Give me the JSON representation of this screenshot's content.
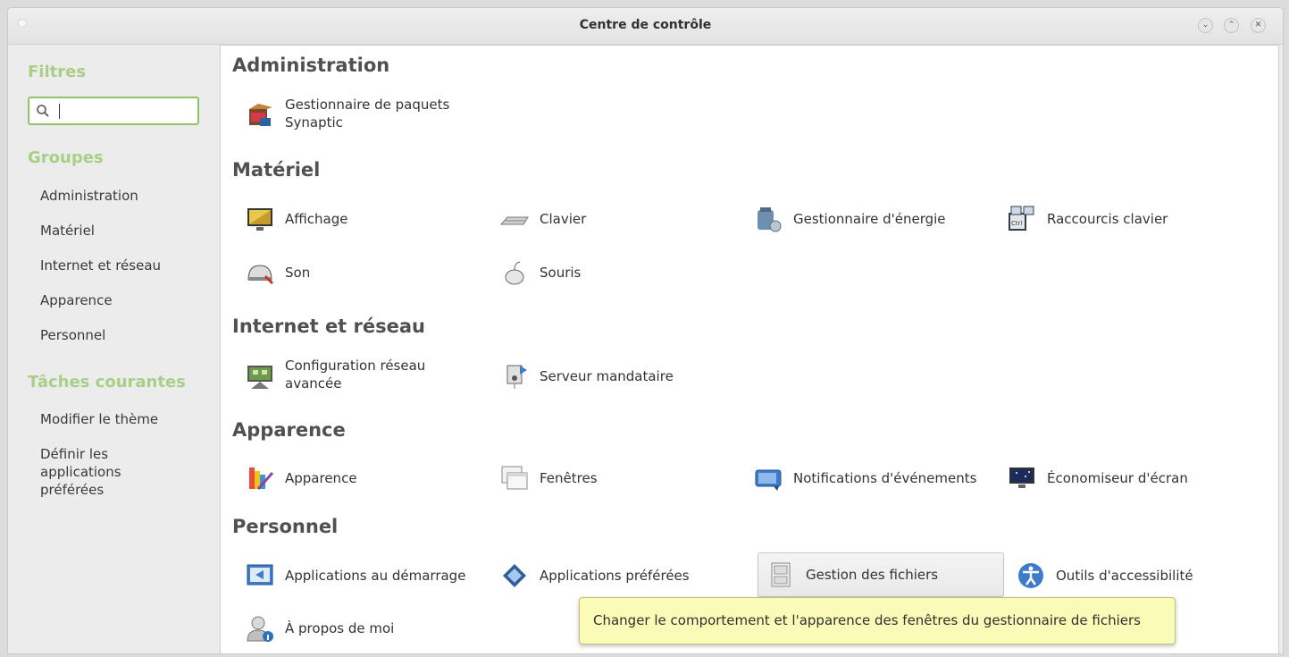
{
  "window": {
    "title": "Centre de contrôle"
  },
  "sidebar": {
    "filters_heading": "Filtres",
    "search": {
      "value": "",
      "placeholder": ""
    },
    "groups_heading": "Groupes",
    "groups": [
      {
        "label": "Administration"
      },
      {
        "label": "Matériel"
      },
      {
        "label": "Internet et réseau"
      },
      {
        "label": "Apparence"
      },
      {
        "label": "Personnel"
      }
    ],
    "tasks_heading": "Tâches courantes",
    "tasks": [
      {
        "label": "Modifier le thème"
      },
      {
        "label": "Définir les\napplications\npréférées"
      }
    ]
  },
  "categories": [
    {
      "title": "Administration",
      "items": [
        {
          "label": "Gestionnaire de paquets\nSynaptic",
          "icon": "package-manager-icon"
        }
      ]
    },
    {
      "title": "Matériel",
      "items": [
        {
          "label": "Affichage",
          "icon": "display-icon"
        },
        {
          "label": "Clavier",
          "icon": "keyboard-icon"
        },
        {
          "label": "Gestionnaire d'énergie",
          "icon": "power-manager-icon"
        },
        {
          "label": "Raccourcis clavier",
          "icon": "keyboard-shortcuts-icon"
        },
        {
          "label": "Son",
          "icon": "sound-icon"
        },
        {
          "label": "Souris",
          "icon": "mouse-icon"
        }
      ]
    },
    {
      "title": "Internet et réseau",
      "items": [
        {
          "label": "Configuration réseau\navancée",
          "icon": "network-config-icon"
        },
        {
          "label": "Serveur mandataire",
          "icon": "proxy-server-icon"
        }
      ]
    },
    {
      "title": "Apparence",
      "items": [
        {
          "label": "Apparence",
          "icon": "appearance-icon"
        },
        {
          "label": "Fenêtres",
          "icon": "windows-icon"
        },
        {
          "label": "Notifications d'événements",
          "icon": "notifications-icon"
        },
        {
          "label": "Économiseur d'écran",
          "icon": "screensaver-icon"
        }
      ]
    },
    {
      "title": "Personnel",
      "items": [
        {
          "label": "Applications au démarrage",
          "icon": "startup-applications-icon"
        },
        {
          "label": "Applications préférées",
          "icon": "preferred-applications-icon"
        },
        {
          "label": "Gestion des fichiers",
          "icon": "file-management-icon",
          "selected": true
        },
        {
          "label": "Outils d'accessibilité",
          "icon": "accessibility-icon"
        },
        {
          "label": "À propos de moi",
          "icon": "about-me-icon"
        }
      ]
    }
  ],
  "tooltip": {
    "text": "Changer le comportement et l'apparence des fenêtres du gestionnaire de fichiers"
  },
  "colors": {
    "accent": "#8fc56a",
    "heading_green": "#a9cf86",
    "tooltip_bg": "#fbfbb8"
  }
}
